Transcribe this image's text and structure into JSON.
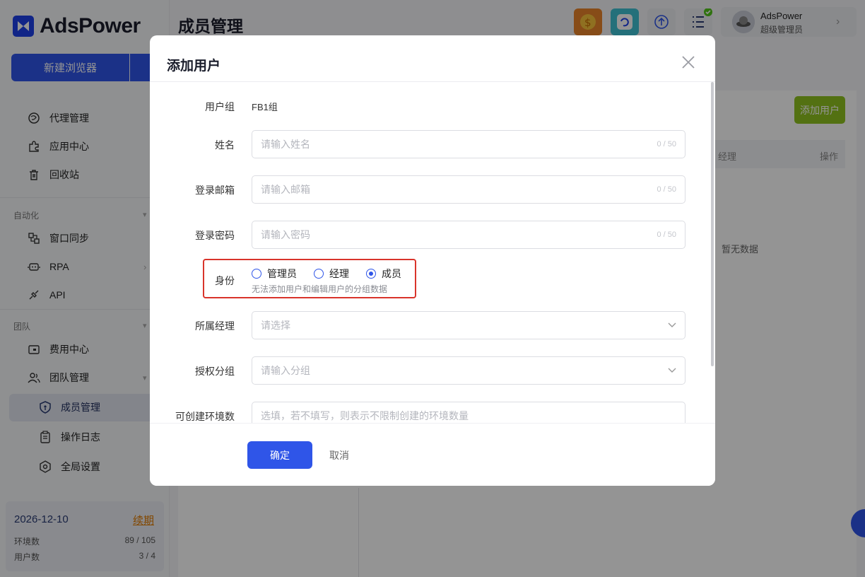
{
  "brand": {
    "name": "AdsPower"
  },
  "sidebar": {
    "new_browser_label": "新建浏览器",
    "items_top": [
      {
        "label": "代理管理",
        "icon": "proxy-icon"
      },
      {
        "label": "应用中心",
        "icon": "puzzle-icon"
      },
      {
        "label": "回收站",
        "icon": "trash-icon"
      }
    ],
    "section_automation": "自动化",
    "items_automation": [
      {
        "label": "窗口同步",
        "icon": "sync-icon"
      },
      {
        "label": "RPA",
        "icon": "robot-icon"
      },
      {
        "label": "API",
        "icon": "plug-icon"
      }
    ],
    "section_team": "团队",
    "items_team": [
      {
        "label": "费用中心",
        "icon": "wallet-icon"
      },
      {
        "label": "团队管理",
        "icon": "team-icon"
      },
      {
        "label": "成员管理",
        "icon": "shield-icon",
        "active": true
      },
      {
        "label": "操作日志",
        "icon": "clipboard-icon"
      },
      {
        "label": "全局设置",
        "icon": "settings-icon"
      }
    ],
    "plan": {
      "date": "2026-12-10",
      "renew_label": "续期",
      "env_label": "环境数",
      "env_value": "89 / 105",
      "user_label": "用户数",
      "user_value": "3 / 4"
    }
  },
  "header": {
    "title": "成员管理",
    "user_name": "AdsPower",
    "user_role": "超级管理员"
  },
  "main": {
    "add_user_label": "添加用户",
    "col_manager": "经理",
    "col_ops": "操作",
    "empty": "暂无数据"
  },
  "modal": {
    "title": "添加用户",
    "group_label": "用户组",
    "group_value": "FB1组",
    "name_label": "姓名",
    "name_placeholder": "请输入姓名",
    "name_count": "0 / 50",
    "email_label": "登录邮箱",
    "email_placeholder": "请输入邮箱",
    "email_count": "0 / 50",
    "password_label": "登录密码",
    "password_placeholder": "请输入密码",
    "password_count": "0 / 50",
    "role_label": "身份",
    "roles": [
      "管理员",
      "经理",
      "成员"
    ],
    "role_selected": "成员",
    "role_hint": "无法添加用户和编辑用户的分组数据",
    "manager_label": "所属经理",
    "manager_placeholder": "请选择",
    "group_auth_label": "授权分组",
    "group_auth_placeholder": "请输入分组",
    "env_limit_label": "可创建环境数",
    "env_limit_placeholder": "选填，若不填写，则表示不限制创建的环境数量",
    "ok_label": "确定",
    "cancel_label": "取消"
  },
  "colors": {
    "primary": "#2f55e8",
    "accent_green": "#8fc31f",
    "highlight_red": "#d9342b"
  }
}
